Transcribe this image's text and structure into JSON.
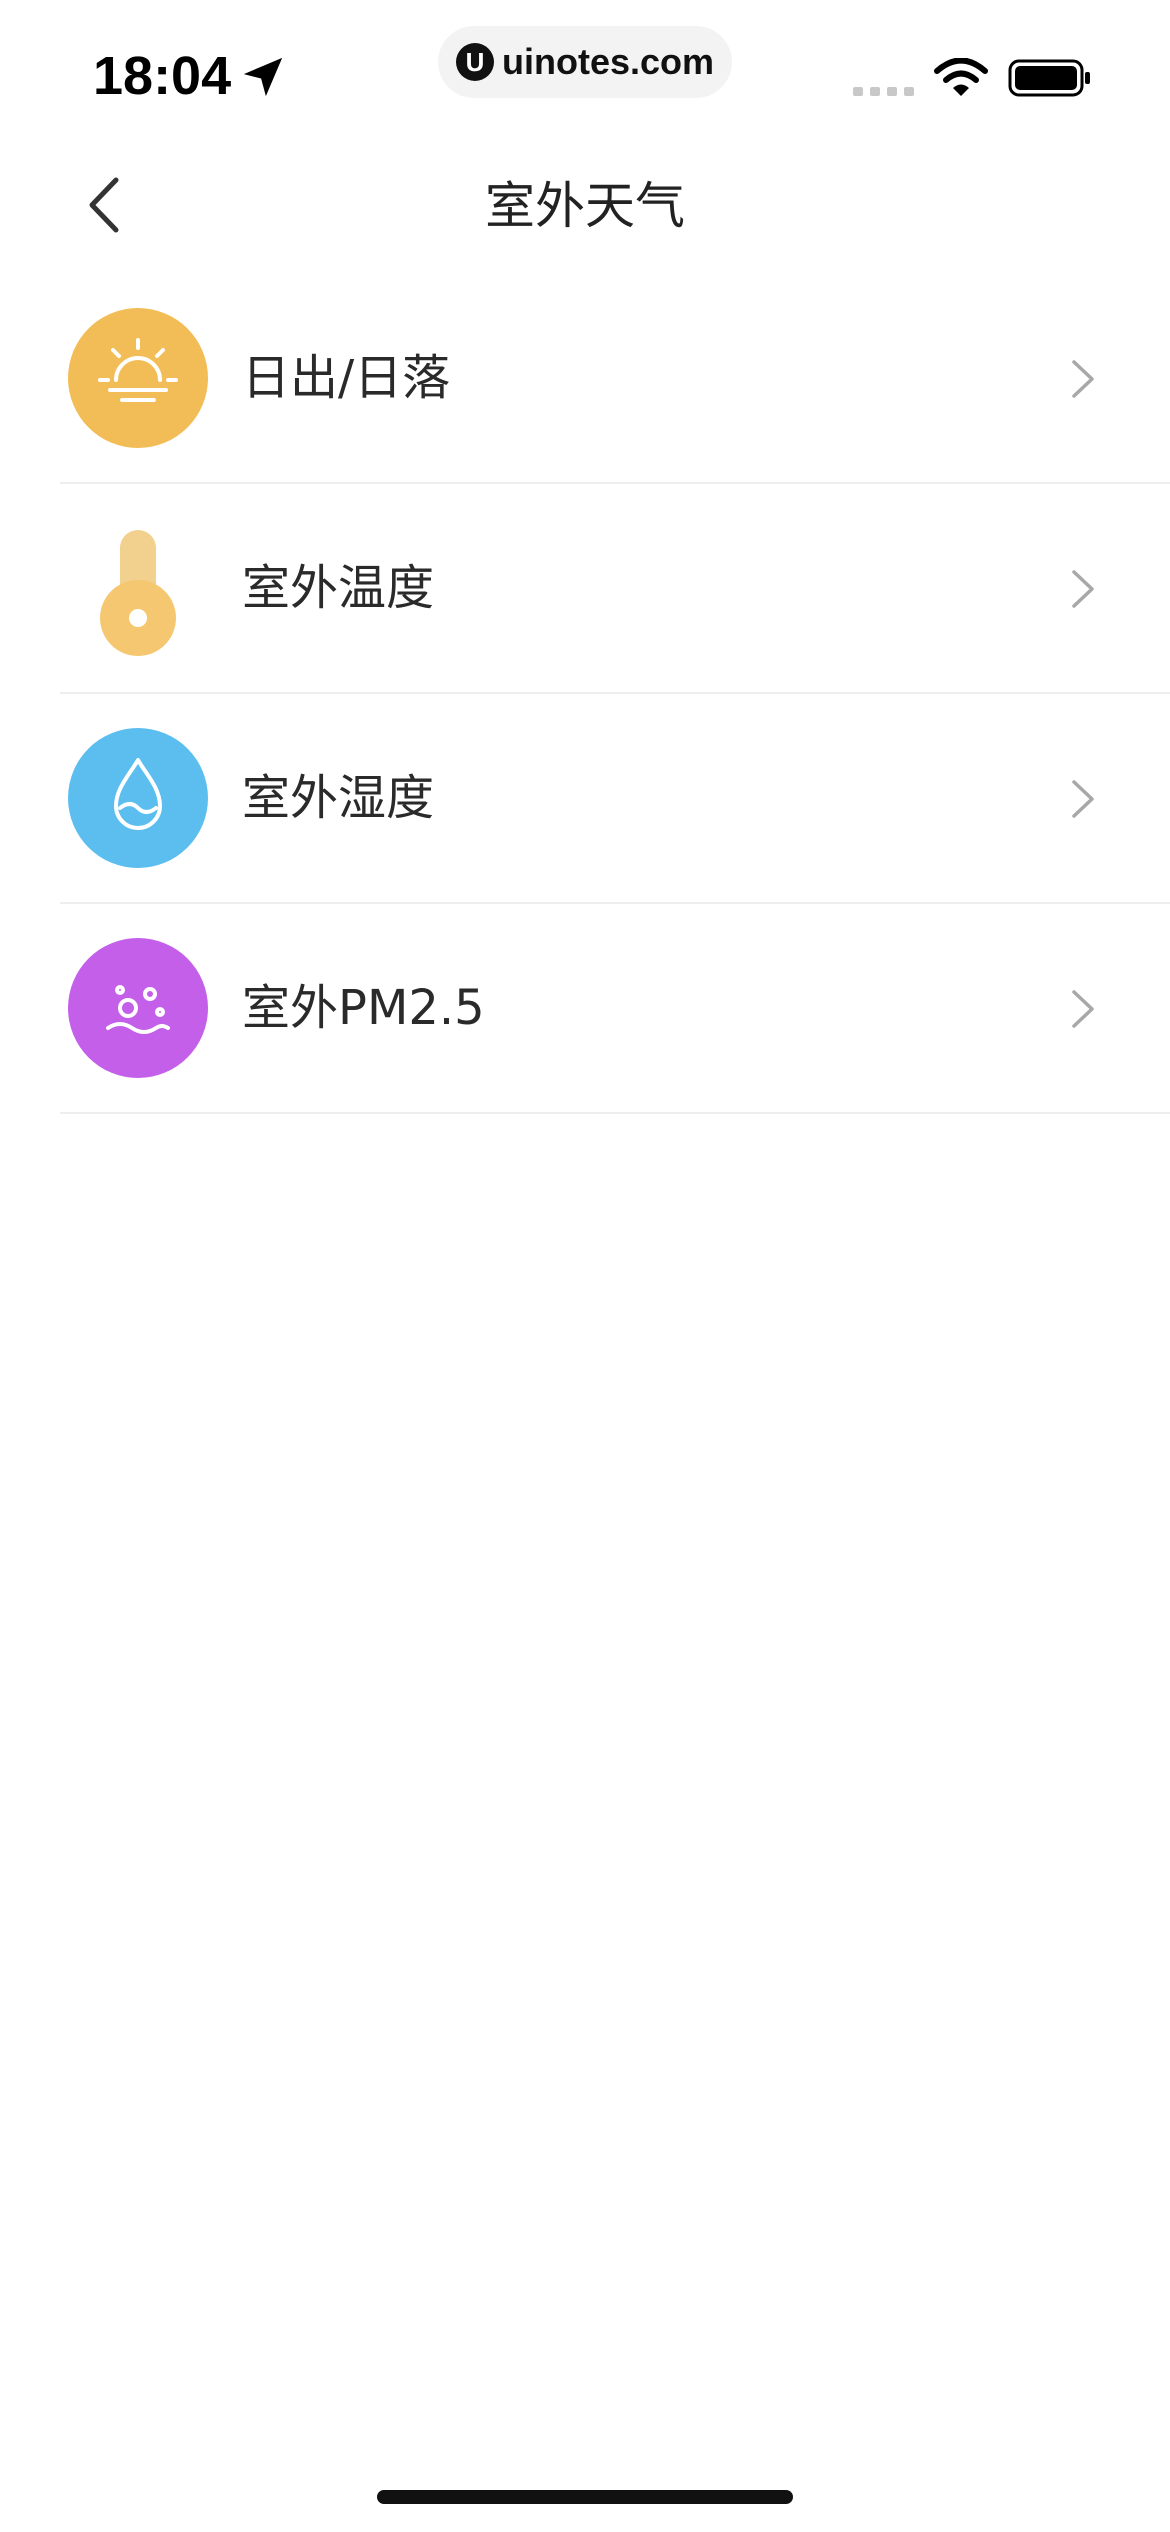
{
  "status_bar": {
    "time": "18:04",
    "url": "uinotes.com",
    "url_logo_letter": "U"
  },
  "nav": {
    "title": "室外天气"
  },
  "list": {
    "items": [
      {
        "label": "日出/日落",
        "icon": "sunrise-icon",
        "color": "#F2BD57"
      },
      {
        "label": "室外温度",
        "icon": "thermometer-icon",
        "color": "#F5C770"
      },
      {
        "label": "室外湿度",
        "icon": "water-drop-icon",
        "color": "#5BBEEF"
      },
      {
        "label": "室外PM2.5",
        "icon": "pm25-icon",
        "color": "#C45FEA"
      }
    ]
  }
}
